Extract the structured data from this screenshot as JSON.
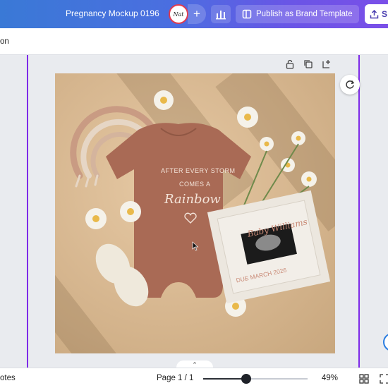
{
  "topbar": {
    "doc_title": "Pregnancy Mockup 0196",
    "avatar_initials": "Nat",
    "add_collaborator": "+",
    "publish_label": "Publish as Brand Template",
    "share_label": "S"
  },
  "subrow": {
    "left_text": "on"
  },
  "design": {
    "onesie_line1": "AFTER EVERY STORM",
    "onesie_line2": "COMES A",
    "onesie_line3": "Rainbow",
    "board_name": "Baby Williams",
    "board_due": "DUE MARCH 2026"
  },
  "bottombar": {
    "notes_label": "otes",
    "page_indicator": "Page 1 / 1",
    "zoom_percent": "49%",
    "zoom_level": 0.41
  },
  "colors": {
    "accent": "#7d2ae8",
    "canvas_bg": "#d6b68f",
    "onesie": "#a96a55"
  }
}
